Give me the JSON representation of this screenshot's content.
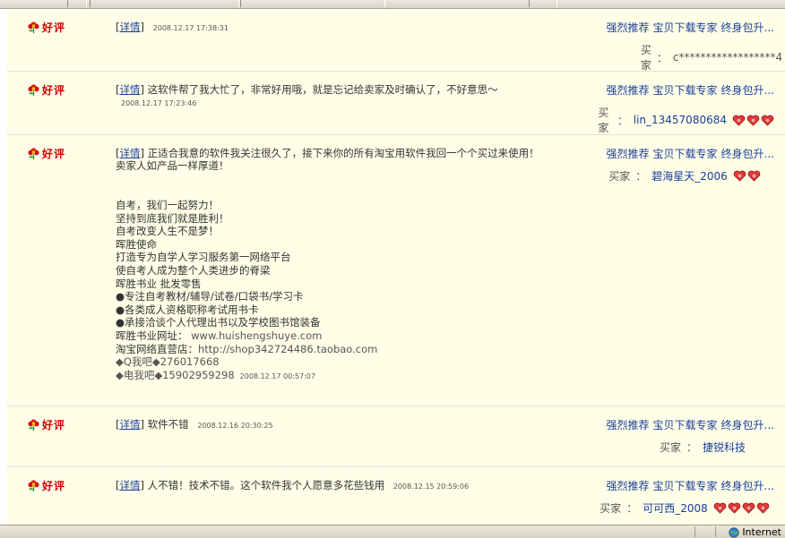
{
  "status_bar": {
    "zone": "Internet"
  },
  "labels": {
    "detail": "详情",
    "buyer": "买家",
    "colon": "：",
    "rating": "好评"
  },
  "links": [
    "强烈推荐",
    "宝贝下载专家",
    "终身包升..."
  ],
  "reviews": [
    {
      "text": "",
      "date": "2008.12.17 17:38:31",
      "buyer": "c******************4",
      "hearts": 0
    },
    {
      "text": "这软件帮了我大忙了，非常好用哦，就是忘记给卖家及时确认了，不好意思～",
      "date": "2008.12.17 17:23:46",
      "buyer": "lin_13457080684",
      "hearts": 3
    },
    {
      "text": "正适合我意的软件我关注很久了，接下来你的所有淘宝用软件我回一个个买过来使用！卖家人如产品一样厚道！",
      "extra_lines": [
        "自考，我们一起努力！",
        "坚持到底我们就是胜利！",
        "自考改变人生不是梦！",
        "晖胜使命",
        "打造专为自学人学习服务第一网络平台",
        "使自考人成为整个人类进步的脊梁",
        "晖胜书业  批发零售",
        "●专注自考教材/辅导/试卷/口袋书/学习卡",
        "●各类成人资格职称考试用书卡",
        "●承接洽谈个人代理出书以及学校图书馆装备"
      ],
      "url_label": "晖胜书业网址：",
      "url": "www.huishengshuye.com",
      "shop_label": "淘宝网络直营店：",
      "shop": "http://shop342724486.taobao.com",
      "qq": "◆Q我吧◆276017668",
      "phone": "◆电我吧◆15902959298",
      "date": "2008.12.17 00:57:07",
      "buyer": "碧海星天_2006",
      "hearts": 2
    },
    {
      "text": "软件不错",
      "date": "2008.12.16 20:30:25",
      "buyer": "捷锐科技",
      "hearts": 0
    },
    {
      "text": "人不错！技术不错。这个软件我个人愿意多花些钱用",
      "date": "2008.12.15 20:59:06",
      "buyer": "可可西_2008",
      "hearts": 4
    }
  ]
}
